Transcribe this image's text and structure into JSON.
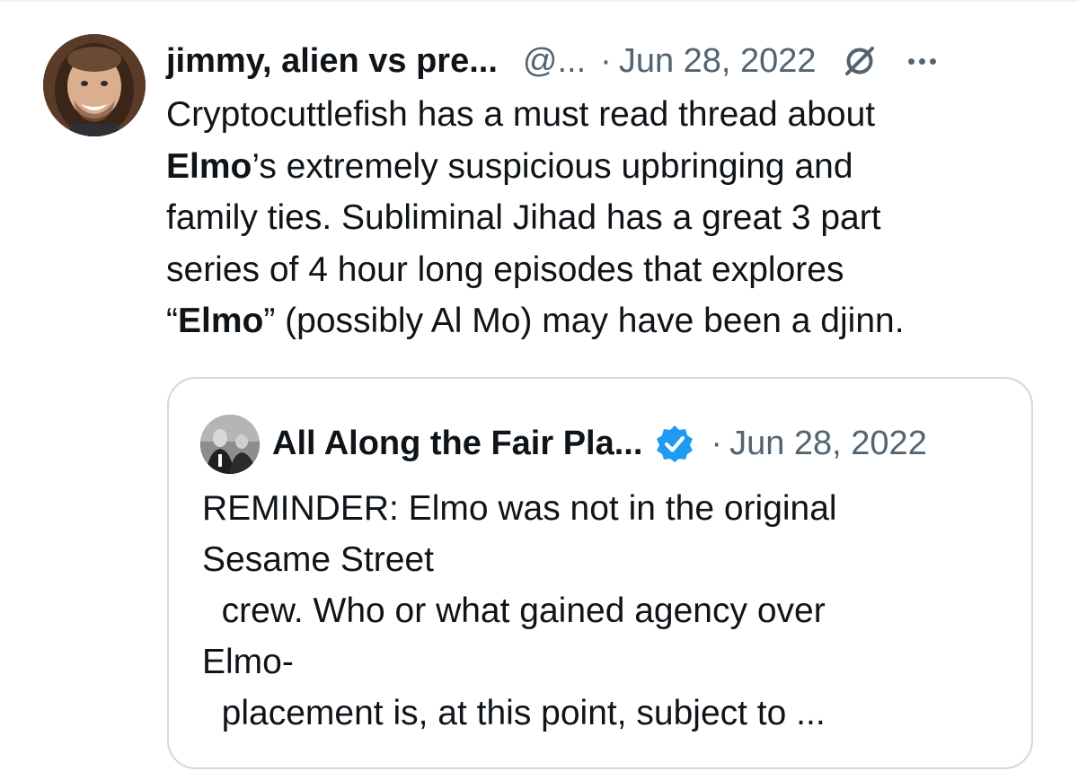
{
  "tweet": {
    "author_name": "jimmy, alien vs pre...",
    "handle": "@...",
    "separator": "·",
    "date": "Jun 28, 2022",
    "icons": {
      "avatar": "profile-photo",
      "grok": "grok-icon",
      "more": "more-icon"
    },
    "body_lines": [
      {
        "parts": [
          {
            "text": "Cryptocuttlefish has a must read thread about",
            "bold": false
          }
        ]
      },
      {
        "parts": [
          {
            "text": "Elmo",
            "bold": true
          },
          {
            "text": "’s extremely suspicious upbringing and",
            "bold": false
          }
        ]
      },
      {
        "parts": [
          {
            "text": "family ties. Subliminal Jihad has a great 3 part",
            "bold": false
          }
        ]
      },
      {
        "parts": [
          {
            "text": "series of 4 hour long episodes that explores",
            "bold": false
          }
        ]
      },
      {
        "parts": [
          {
            "text": "“",
            "bold": false
          },
          {
            "text": "Elmo",
            "bold": true
          },
          {
            "text": "” (possibly Al Mo) may have been a djinn.",
            "bold": false
          }
        ]
      }
    ]
  },
  "quote": {
    "author_name": "All Along the Fair Pla...",
    "verified": true,
    "separator": "·",
    "date": "Jun 28, 2022",
    "icons": {
      "avatar": "profile-photo",
      "verified": "verified-badge-icon"
    },
    "text_lines": [
      "REMINDER: Elmo was not in the original",
      "Sesame Street",
      "  crew. Who or what gained agency over",
      "Elmo-",
      "  placement is, at this point, subject to ..."
    ]
  },
  "colors": {
    "text": "#0f1419",
    "secondary": "#536471",
    "border": "#cfd9de",
    "verified": "#1d9bf0"
  }
}
